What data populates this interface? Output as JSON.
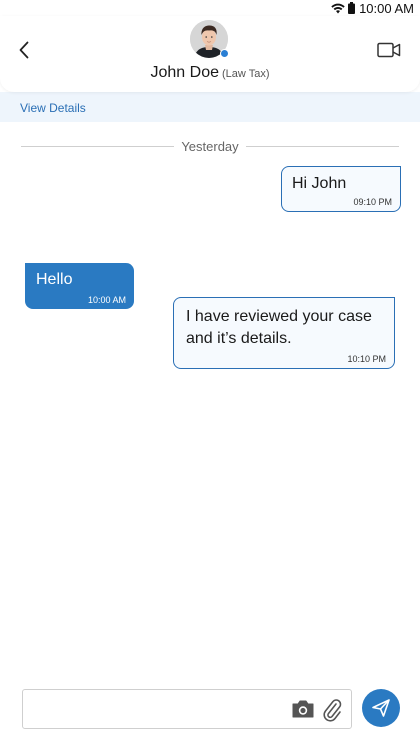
{
  "status_bar": {
    "time": "10:00 AM",
    "icons": [
      "wifi-icon",
      "battery-icon"
    ]
  },
  "header": {
    "contact_name": "John Doe",
    "contact_role": "(Law Tax)",
    "online": true,
    "icons": {
      "back": "chevron-left-icon",
      "video": "video-camera-icon"
    }
  },
  "details": {
    "view_details_label": "View Details"
  },
  "chat": {
    "date_separator": "Yesterday",
    "messages": [
      {
        "direction": "outgoing",
        "text": "Hi John",
        "time": "09:10 PM"
      },
      {
        "direction": "incoming",
        "text": "Hello",
        "time": "10:00 AM"
      },
      {
        "direction": "outgoing",
        "text": "I have reviewed your case and it’s details.",
        "time": "10:10 PM"
      }
    ]
  },
  "composer": {
    "placeholder": "",
    "icons": {
      "camera": "camera-icon",
      "attach": "paperclip-icon",
      "send": "send-icon"
    }
  },
  "colors": {
    "accent": "#2a7ac2",
    "details_strip": "#eef5fc",
    "outgoing_border": "#2a6fb5",
    "online_dot": "#2a7fd4"
  }
}
